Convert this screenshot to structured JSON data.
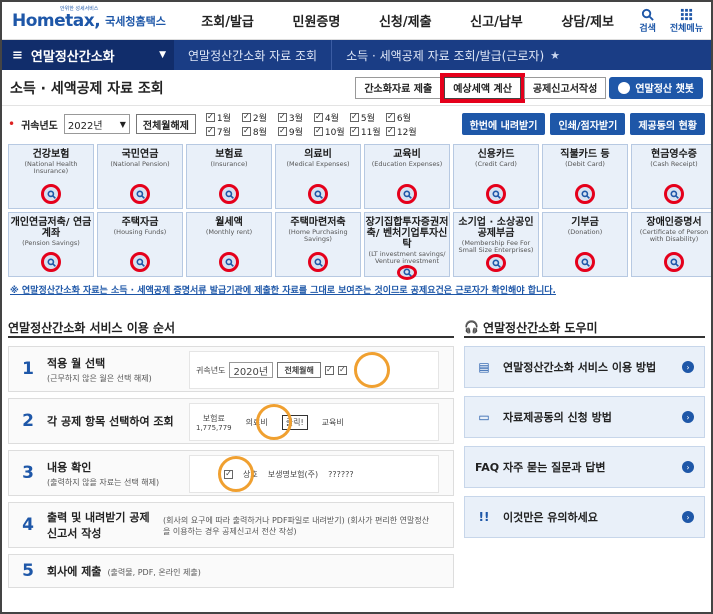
{
  "brand": {
    "sub": "안위한 성세서비스",
    "main": "Hometax,",
    "kr": "국세청홈택스"
  },
  "nav": [
    "조회/발급",
    "민원증명",
    "신청/제출",
    "신고/납부",
    "상담/제보"
  ],
  "topicons": {
    "search": "검색",
    "menu": "전체메뉴"
  },
  "subnav": {
    "menu": "연말정산간소화",
    "crumb1": "연말정산간소화 자료 조회",
    "crumb2": "소득 · 세액공제 자료 조회/발급(근로자)"
  },
  "title": "소득 · 세액공제 자료 조회",
  "title_buttons": {
    "simple": "간소화자료 제출",
    "estimate": "예상세액 계산",
    "declare": "공제신고서작성",
    "chatbot": "연말정산 챗봇"
  },
  "filter": {
    "label": "귀속년도",
    "year": "2022년",
    "select_all": "전체월해제",
    "months": [
      "1월",
      "2월",
      "3월",
      "4월",
      "5월",
      "6월",
      "7월",
      "8월",
      "9월",
      "10월",
      "11월",
      "12월"
    ],
    "download": "한번에 내려받기",
    "print": "인쇄/점자받기",
    "status": "제공동의 현황"
  },
  "cards": [
    {
      "kn": "건강보험",
      "en": "(National Health Insurance)"
    },
    {
      "kn": "국민연금",
      "en": "(National Pension)"
    },
    {
      "kn": "보험료",
      "en": "(Insurance)"
    },
    {
      "kn": "의료비",
      "en": "(Medical Expenses)"
    },
    {
      "kn": "교육비",
      "en": "(Education Expenses)"
    },
    {
      "kn": "신용카드",
      "en": "(Credit Card)"
    },
    {
      "kn": "직불카드 등",
      "en": "(Debit Card)"
    },
    {
      "kn": "현금영수증",
      "en": "(Cash Receipt)"
    },
    {
      "kn": "개인연금저축/ 연금계좌",
      "en": "(Pension Savings)"
    },
    {
      "kn": "주택자금",
      "en": "(Housing Funds)"
    },
    {
      "kn": "월세액",
      "en": "(Monthly rent)"
    },
    {
      "kn": "주택마련저축",
      "en": "(Home Purchasing Savings)"
    },
    {
      "kn": "장기집합투자증권저축/ 벤처기업투자신탁",
      "en": "(LT investment savings/ Venture investment"
    },
    {
      "kn": "소기업 · 소상공인 공제부금",
      "en": "(Membership Fee For Small Size Enterprises)"
    },
    {
      "kn": "기부금",
      "en": "(Donation)"
    },
    {
      "kn": "장애인증명서",
      "en": "(Certificate of Person with Disability)"
    }
  ],
  "notice": "※ 연말정산간소화 자료는 소득 · 세액공제 증명서류 발급기관에 제출한 자료를 그대로 보여주는 것이므로 공제요건은 근로자가 확인해야 합니다.",
  "guide": {
    "title": "연말정산간소화 서비스 이용 순서",
    "steps": [
      {
        "n": "1",
        "t": "적용 월 선택",
        "s": "(근무하지 않은 월은 선택 해제)",
        "p": [
          "귀속년도",
          "2020년",
          "전체월해"
        ]
      },
      {
        "n": "2",
        "t": "각 공제 항목 선택하여 조회",
        "s": "",
        "p": [
          "보험료",
          "의료비",
          "교육비",
          "1,775,779",
          "클릭!"
        ]
      },
      {
        "n": "3",
        "t": "내용 확인",
        "s": "(출력하지 않을 자료는 선택 해제)",
        "p": [
          "상호",
          "보생명보험(주)",
          "??????"
        ]
      },
      {
        "n": "4",
        "t": "출력 및 내려받기 공제신고서 작성",
        "s": "(회사의 요구에 따라 출력하거나 PDF파일로 내려받기) (회사가 편리한 연말정산을 이용하는 경우 공제신고서 전산 작성)",
        "p": []
      },
      {
        "n": "5",
        "t": "회사에 제출",
        "s": "(출력물, PDF, 온라인 제출)",
        "p": []
      }
    ]
  },
  "help": {
    "title": "연말정산간소화 도우미",
    "items": [
      {
        "icon": "doc-icon",
        "t": "연말정산간소화 서비스 이용 방법"
      },
      {
        "icon": "form-icon",
        "t": "자료제공동의 신청 방법"
      },
      {
        "icon": "faq-icon",
        "t": "FAQ 자주 묻는 질문과 답변"
      },
      {
        "icon": "warning-icon",
        "t": "이것만은 유의하세요"
      }
    ]
  }
}
